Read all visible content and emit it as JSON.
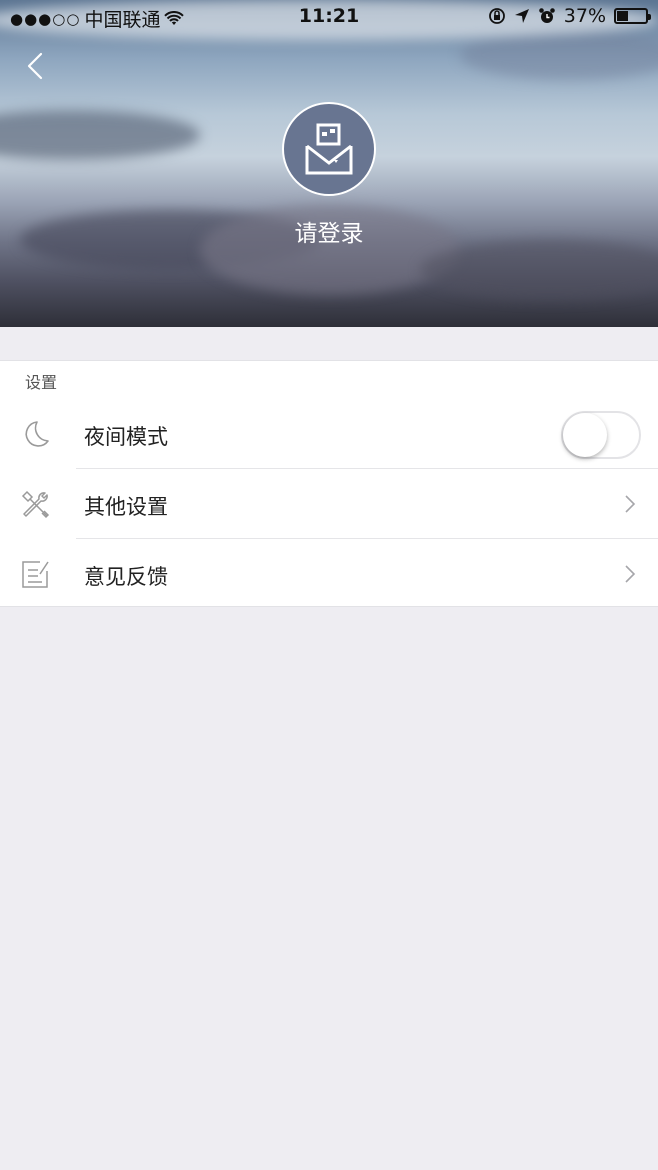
{
  "status_bar": {
    "signal": "●●●○○",
    "carrier": "中国联通",
    "time": "11:21",
    "battery_percent": "37%",
    "battery_level": 0.37
  },
  "header": {
    "login_label": "请登录"
  },
  "settings": {
    "section_title": "设置",
    "items": [
      {
        "label": "夜间模式",
        "icon": "moon-icon",
        "control": "toggle",
        "toggle_on": false
      },
      {
        "label": "其他设置",
        "icon": "tools-icon",
        "control": "chevron"
      },
      {
        "label": "意见反馈",
        "icon": "feedback-edit-icon",
        "control": "chevron"
      }
    ]
  },
  "colors": {
    "avatar_bg": "#687591",
    "page_bg": "#eeedf2",
    "icon_gray": "#9a9a9a"
  }
}
